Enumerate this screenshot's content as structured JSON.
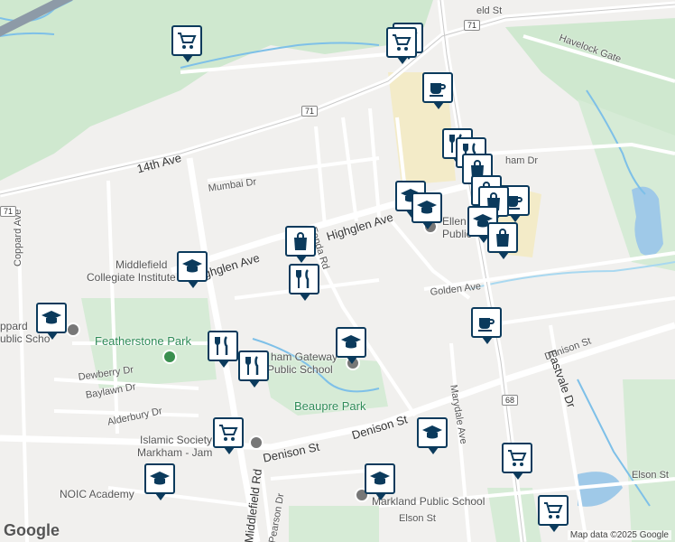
{
  "map": {
    "streets": [
      {
        "name": "14th Ave"
      },
      {
        "name": "Highglen Ave"
      },
      {
        "name": "Highglen Ave"
      },
      {
        "name": "Mumbai Dr"
      },
      {
        "name": "Coppard Ave"
      },
      {
        "name": "Golden Ave"
      },
      {
        "name": "Denison St"
      },
      {
        "name": "Denison St"
      },
      {
        "name": "Denison St"
      },
      {
        "name": "Eastvale Dr"
      },
      {
        "name": "Marydale Ave"
      },
      {
        "name": "Middlefield Rd"
      },
      {
        "name": "Dewberry Dr"
      },
      {
        "name": "Baylawn Dr"
      },
      {
        "name": "Alderbury Dr"
      },
      {
        "name": "Elson St"
      },
      {
        "name": "Elson St"
      },
      {
        "name": "Havelock Gate"
      },
      {
        "name": "Fonda Rd"
      },
      {
        "name": "Pearson Dr"
      },
      {
        "name": "ham Dr"
      },
      {
        "name": "eld St"
      }
    ],
    "pois": [
      {
        "name": "Middlefield"
      },
      {
        "name": "Collegiate Institute"
      },
      {
        "name": "Featherstone Park"
      },
      {
        "name": "Beaupre Park"
      },
      {
        "name": "ham Gateway"
      },
      {
        "name": "Public School"
      },
      {
        "name": "Islamic Society"
      },
      {
        "name": "Markham - Jam"
      },
      {
        "name": "NOIC Academy"
      },
      {
        "name": "Markland Public School"
      },
      {
        "name": "Ellen"
      },
      {
        "name": "Public"
      },
      {
        "name": "ppard"
      },
      {
        "name": "ublic Scho"
      }
    ],
    "shields": [
      "71",
      "71",
      "71",
      "68"
    ],
    "attribution": "Map data ©2025 Google",
    "logo": "Google"
  },
  "markers": [
    {
      "type": "shopping-cart"
    },
    {
      "type": "shopping-cart"
    },
    {
      "type": "shopping-cart"
    },
    {
      "type": "cafe"
    },
    {
      "type": "restaurant"
    },
    {
      "type": "restaurant"
    },
    {
      "type": "shopping-bag"
    },
    {
      "type": "school"
    },
    {
      "type": "school"
    },
    {
      "type": "shopping-bag"
    },
    {
      "type": "cafe"
    },
    {
      "type": "shopping-bag"
    },
    {
      "type": "shopping-bag"
    },
    {
      "type": "school"
    },
    {
      "type": "restaurant"
    },
    {
      "type": "school"
    },
    {
      "type": "school"
    },
    {
      "type": "cafe"
    },
    {
      "type": "restaurant"
    },
    {
      "type": "restaurant"
    },
    {
      "type": "shopping-cart"
    },
    {
      "type": "school"
    },
    {
      "type": "school"
    },
    {
      "type": "shopping-cart"
    },
    {
      "type": "school"
    },
    {
      "type": "shopping-cart"
    }
  ]
}
